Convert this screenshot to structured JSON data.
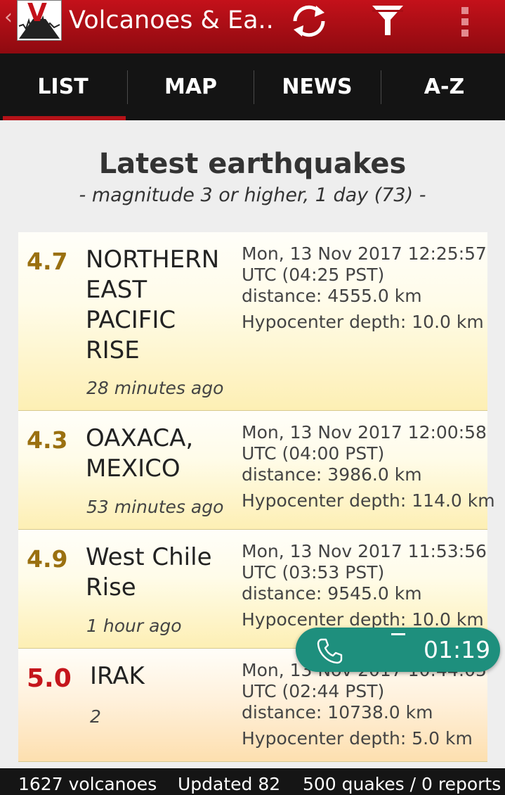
{
  "app": {
    "title": "Volcanoes & Ea..",
    "logo_letter": "V",
    "back_glyph": "‹",
    "actions": [
      "refresh-icon",
      "filter-icon",
      "overflow-menu-icon"
    ]
  },
  "tabs": [
    {
      "label": "LIST",
      "active": true
    },
    {
      "label": "MAP",
      "active": false
    },
    {
      "label": "NEWS",
      "active": false
    },
    {
      "label": "A-Z",
      "active": false
    }
  ],
  "heading": {
    "title": "Latest earthquakes",
    "subtitle": "- magnitude 3 or higher, 1 day (73) -"
  },
  "quakes": [
    {
      "magnitude": "4.7",
      "place_lines": [
        "NORTHERN",
        "EAST",
        "PACIFIC",
        "RISE"
      ],
      "ago": "28 minutes ago",
      "time": "Mon, 13 Nov 2017 12:25:57",
      "time_pst": "UTC (04:25 PST)",
      "distance": "distance: 4555.0 km",
      "depth": "Hypocenter depth: 10.0 km"
    },
    {
      "magnitude": "4.3",
      "place_lines": [
        "OAXACA,",
        "MEXICO"
      ],
      "ago": "53 minutes ago",
      "time": "Mon, 13 Nov 2017 12:00:58",
      "time_pst": "UTC (04:00 PST)",
      "distance": "distance: 3986.0 km",
      "depth": "Hypocenter depth: 114.0 km"
    },
    {
      "magnitude": "4.9",
      "place_lines": [
        "West Chile",
        "Rise"
      ],
      "ago": "1 hour ago",
      "time": "Mon, 13 Nov 2017 11:53:56",
      "time_pst": "UTC (03:53 PST)",
      "distance": "distance: 9545.0 km",
      "depth": "Hypocenter depth: 10.0 km"
    },
    {
      "magnitude": "5.0",
      "place_lines": [
        "IRAK"
      ],
      "ago": "2",
      "time": "Mon, 13 Nov 2017 10:44:05",
      "time_pst": "UTC (02:44 PST)",
      "distance": "distance: 10738.0 km",
      "depth": "Hypocenter depth: 5.0 km"
    }
  ],
  "call": {
    "timer": "01:19"
  },
  "footer": {
    "volcanoes": "1627 volcanoes",
    "updated": "Updated 82",
    "reports": "500 quakes / 0 reports"
  },
  "colors": {
    "actionbar": "#b3101a",
    "tabbar": "#141414",
    "active_tab_indicator": "#b51218",
    "magnitude_moderate": "#9a7010",
    "magnitude_strong": "#c5161c",
    "call_pill": "#1e8f7d"
  }
}
